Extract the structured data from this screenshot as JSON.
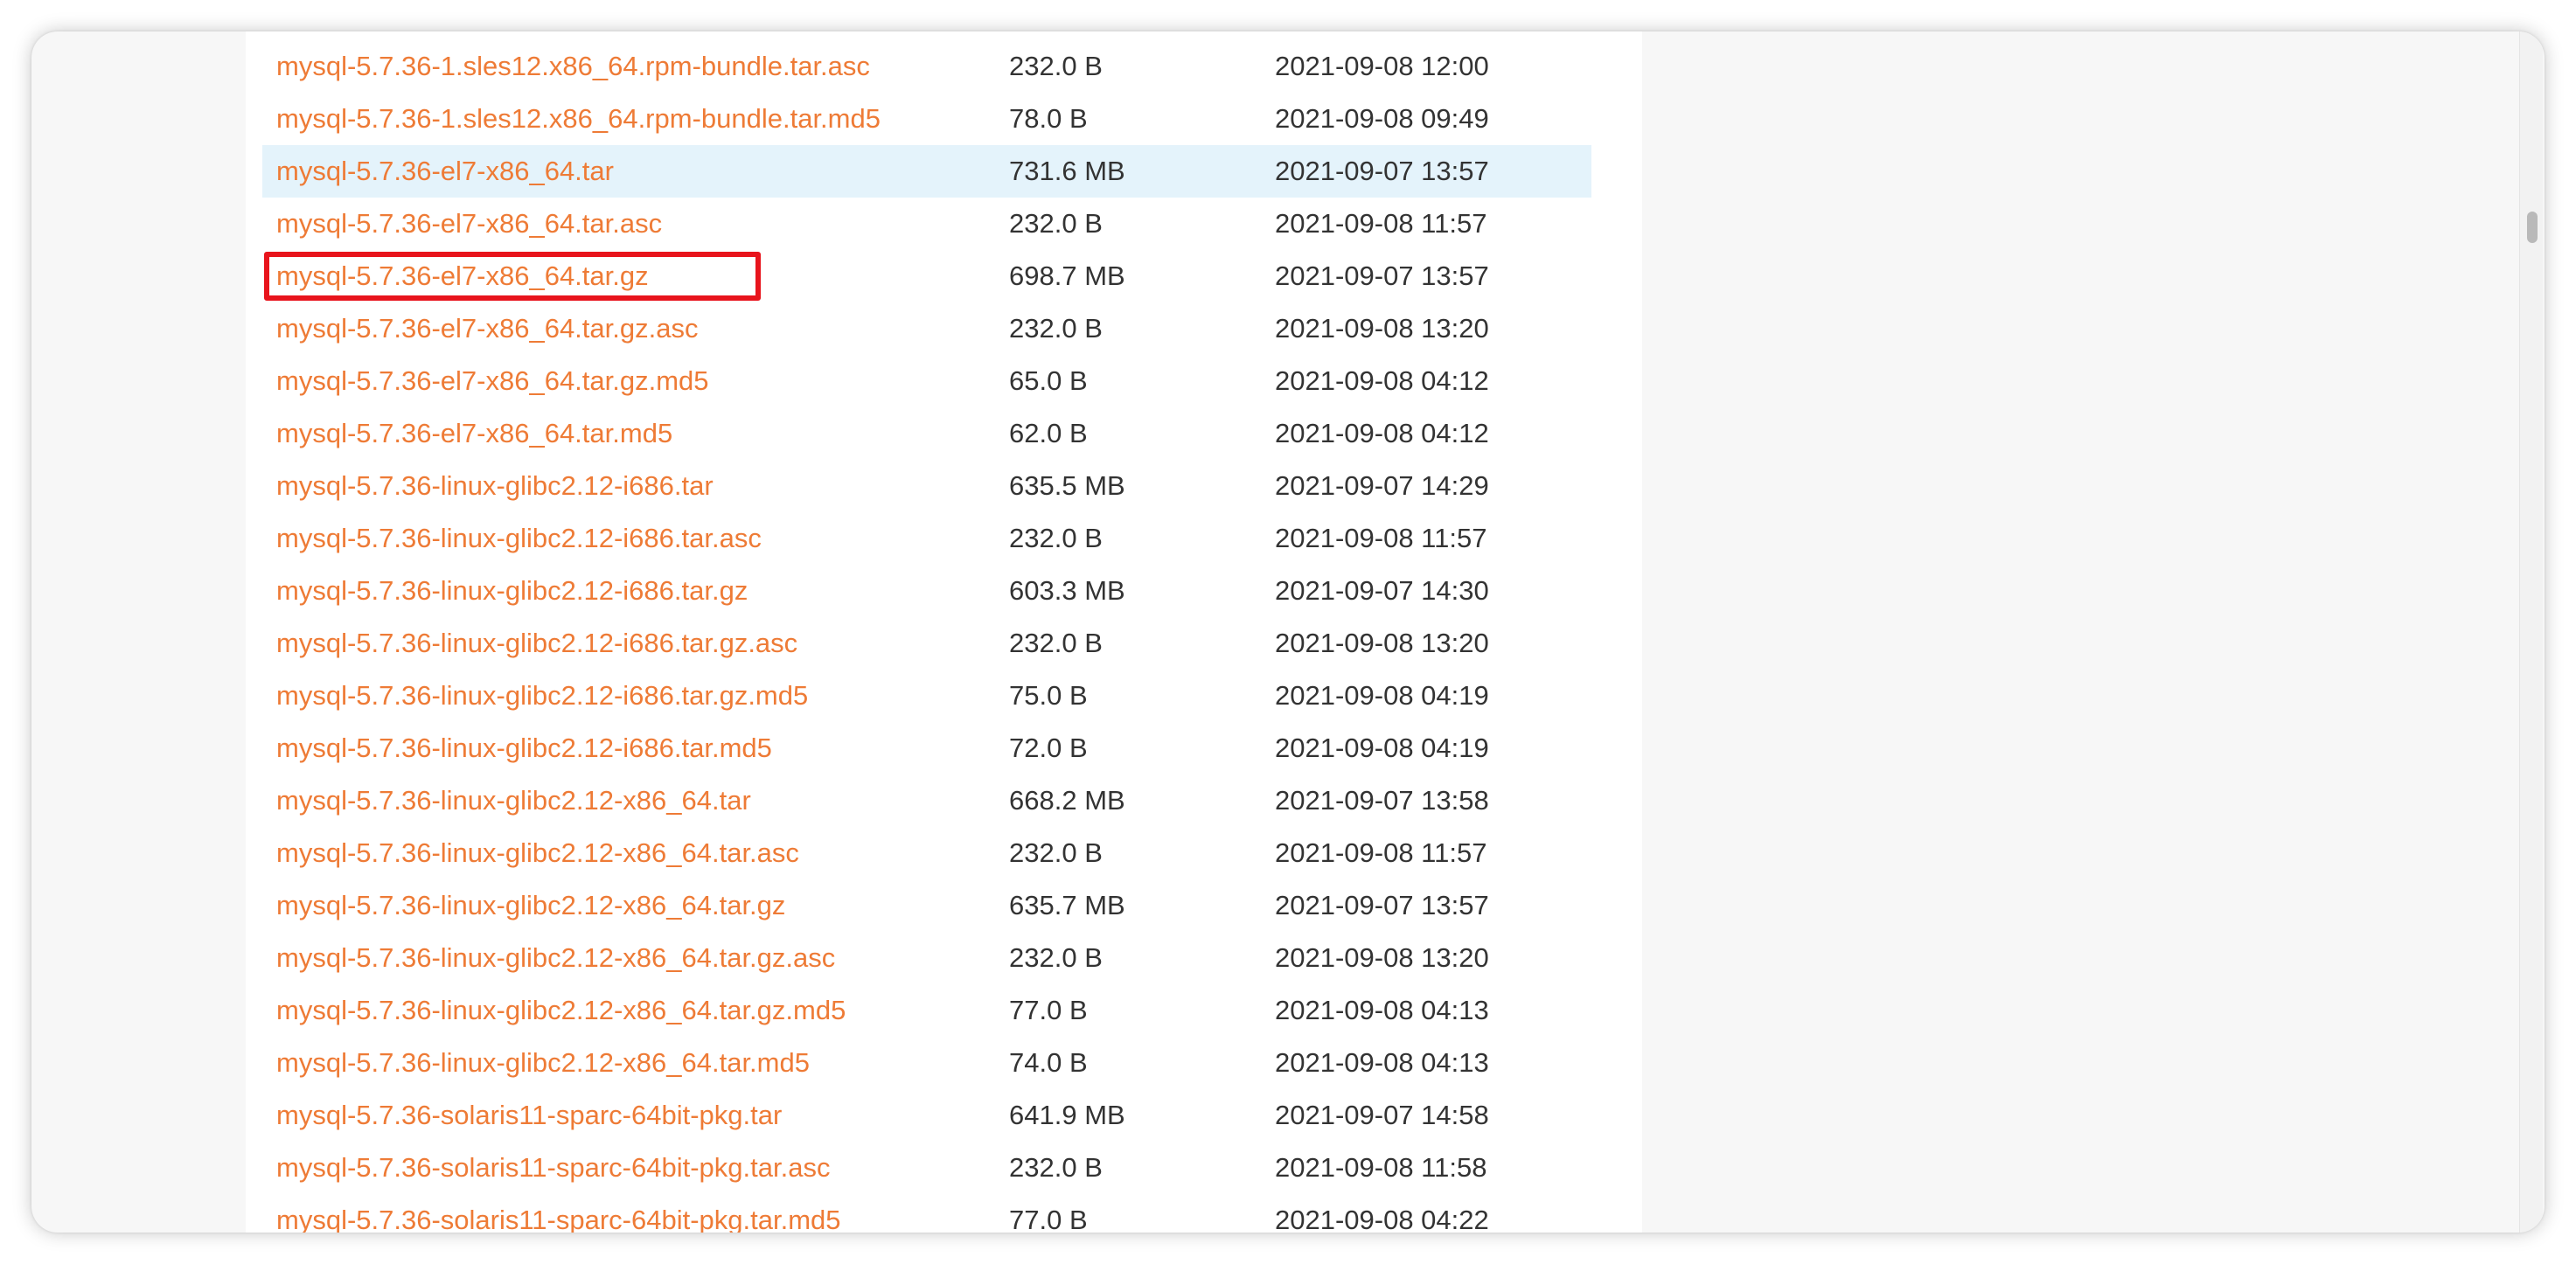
{
  "files": [
    {
      "name": "mysql-5.7.36-1.sles12.x86_64.rpm-bundle.tar.asc",
      "size": "232.0 B",
      "date": "2021-09-08 12:00"
    },
    {
      "name": "mysql-5.7.36-1.sles12.x86_64.rpm-bundle.tar.md5",
      "size": "78.0 B",
      "date": "2021-09-08 09:49"
    },
    {
      "name": "mysql-5.7.36-el7-x86_64.tar",
      "size": "731.6 MB",
      "date": "2021-09-07 13:57"
    },
    {
      "name": "mysql-5.7.36-el7-x86_64.tar.asc",
      "size": "232.0 B",
      "date": "2021-09-08 11:57"
    },
    {
      "name": "mysql-5.7.36-el7-x86_64.tar.gz",
      "size": "698.7 MB",
      "date": "2021-09-07 13:57"
    },
    {
      "name": "mysql-5.7.36-el7-x86_64.tar.gz.asc",
      "size": "232.0 B",
      "date": "2021-09-08 13:20"
    },
    {
      "name": "mysql-5.7.36-el7-x86_64.tar.gz.md5",
      "size": "65.0 B",
      "date": "2021-09-08 04:12"
    },
    {
      "name": "mysql-5.7.36-el7-x86_64.tar.md5",
      "size": "62.0 B",
      "date": "2021-09-08 04:12"
    },
    {
      "name": "mysql-5.7.36-linux-glibc2.12-i686.tar",
      "size": "635.5 MB",
      "date": "2021-09-07 14:29"
    },
    {
      "name": "mysql-5.7.36-linux-glibc2.12-i686.tar.asc",
      "size": "232.0 B",
      "date": "2021-09-08 11:57"
    },
    {
      "name": "mysql-5.7.36-linux-glibc2.12-i686.tar.gz",
      "size": "603.3 MB",
      "date": "2021-09-07 14:30"
    },
    {
      "name": "mysql-5.7.36-linux-glibc2.12-i686.tar.gz.asc",
      "size": "232.0 B",
      "date": "2021-09-08 13:20"
    },
    {
      "name": "mysql-5.7.36-linux-glibc2.12-i686.tar.gz.md5",
      "size": "75.0 B",
      "date": "2021-09-08 04:19"
    },
    {
      "name": "mysql-5.7.36-linux-glibc2.12-i686.tar.md5",
      "size": "72.0 B",
      "date": "2021-09-08 04:19"
    },
    {
      "name": "mysql-5.7.36-linux-glibc2.12-x86_64.tar",
      "size": "668.2 MB",
      "date": "2021-09-07 13:58"
    },
    {
      "name": "mysql-5.7.36-linux-glibc2.12-x86_64.tar.asc",
      "size": "232.0 B",
      "date": "2021-09-08 11:57"
    },
    {
      "name": "mysql-5.7.36-linux-glibc2.12-x86_64.tar.gz",
      "size": "635.7 MB",
      "date": "2021-09-07 13:57"
    },
    {
      "name": "mysql-5.7.36-linux-glibc2.12-x86_64.tar.gz.asc",
      "size": "232.0 B",
      "date": "2021-09-08 13:20"
    },
    {
      "name": "mysql-5.7.36-linux-glibc2.12-x86_64.tar.gz.md5",
      "size": "77.0 B",
      "date": "2021-09-08 04:13"
    },
    {
      "name": "mysql-5.7.36-linux-glibc2.12-x86_64.tar.md5",
      "size": "74.0 B",
      "date": "2021-09-08 04:13"
    },
    {
      "name": "mysql-5.7.36-solaris11-sparc-64bit-pkg.tar",
      "size": "641.9 MB",
      "date": "2021-09-07 14:58"
    },
    {
      "name": "mysql-5.7.36-solaris11-sparc-64bit-pkg.tar.asc",
      "size": "232.0 B",
      "date": "2021-09-08 11:58"
    },
    {
      "name": "mysql-5.7.36-solaris11-sparc-64bit-pkg.tar.md5",
      "size": "77.0 B",
      "date": "2021-09-08 04:22"
    }
  ],
  "colors": {
    "link": "#ee7b36",
    "hover_row": "#e4f3fb",
    "highlight_box": "#e8141c"
  }
}
